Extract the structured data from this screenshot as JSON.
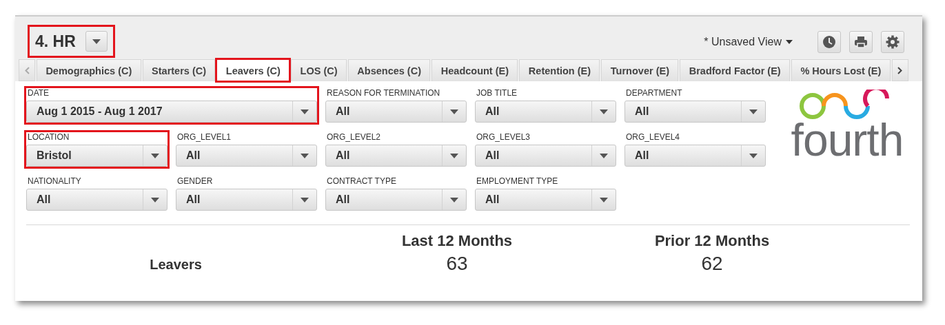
{
  "title": {
    "text": "4. HR",
    "highlighted": true
  },
  "view_menu": {
    "label": "* Unsaved View"
  },
  "tabs": [
    {
      "label": "Demographics (C)",
      "selected": false,
      "highlighted": false
    },
    {
      "label": "Starters (C)",
      "selected": false,
      "highlighted": false
    },
    {
      "label": "Leavers (C)",
      "selected": true,
      "highlighted": true
    },
    {
      "label": "LOS (C)",
      "selected": false,
      "highlighted": false
    },
    {
      "label": "Absences (C)",
      "selected": false,
      "highlighted": false
    },
    {
      "label": "Headcount (E)",
      "selected": false,
      "highlighted": false
    },
    {
      "label": "Retention (E)",
      "selected": false,
      "highlighted": false
    },
    {
      "label": "Turnover (E)",
      "selected": false,
      "highlighted": false
    },
    {
      "label": "Bradford Factor (E)",
      "selected": false,
      "highlighted": false
    },
    {
      "label": "% Hours Lost (E)",
      "selected": false,
      "highlighted": false
    }
  ],
  "filters": [
    {
      "label": "DATE",
      "value": "Aug 1 2015 - Aug 1 2017",
      "wide": true,
      "highlighted": true
    },
    {
      "label": "REASON FOR TERMINATION",
      "value": "All",
      "wide": false,
      "highlighted": false
    },
    {
      "label": "JOB TITLE",
      "value": "All",
      "wide": false,
      "highlighted": false
    },
    {
      "label": "DEPARTMENT",
      "value": "All",
      "wide": false,
      "highlighted": false
    },
    {
      "label": "LOCATION",
      "value": "Bristol",
      "wide": false,
      "highlighted": true
    },
    {
      "label": "ORG_LEVEL1",
      "value": "All",
      "wide": false,
      "highlighted": false
    },
    {
      "label": "ORG_LEVEL2",
      "value": "All",
      "wide": false,
      "highlighted": false
    },
    {
      "label": "ORG_LEVEL3",
      "value": "All",
      "wide": false,
      "highlighted": false
    },
    {
      "label": "ORG_LEVEL4",
      "value": "All",
      "wide": false,
      "highlighted": false
    },
    {
      "label": "NATIONALITY",
      "value": "All",
      "wide": false,
      "highlighted": false
    },
    {
      "label": "GENDER",
      "value": "All",
      "wide": false,
      "highlighted": false
    },
    {
      "label": "CONTRACT TYPE",
      "value": "All",
      "wide": false,
      "highlighted": false
    },
    {
      "label": "EMPLOYMENT TYPE",
      "value": "All",
      "wide": false,
      "highlighted": false
    }
  ],
  "logo": {
    "text": "fourth"
  },
  "summary": {
    "columns": [
      "Last 12 Months",
      "Prior 12 Months"
    ],
    "rows": [
      {
        "label": "Leavers",
        "values": [
          "63",
          "62"
        ]
      }
    ]
  }
}
